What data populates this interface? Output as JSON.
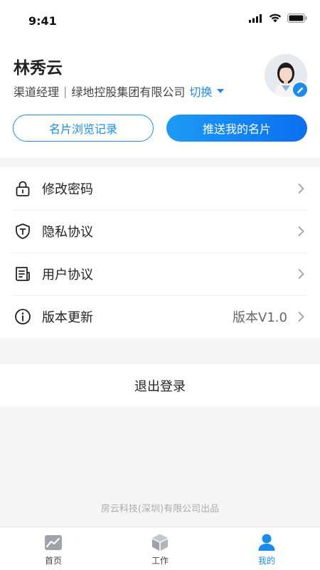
{
  "status_bar": {
    "time": "9:41"
  },
  "profile": {
    "name": "林秀云",
    "role": "渠道经理",
    "separator": "|",
    "company": "绿地控股集团有限公司",
    "switch_label": "切换"
  },
  "actions": {
    "browse_history_label": "名片浏览记录",
    "push_card_label": "推送我的名片"
  },
  "menu": [
    {
      "label": "修改密码",
      "value": "",
      "icon": "lock-icon"
    },
    {
      "label": "隐私协议",
      "value": "",
      "icon": "shield-icon"
    },
    {
      "label": "用户协议",
      "value": "",
      "icon": "document-icon"
    },
    {
      "label": "版本更新",
      "value": "版本V1.0",
      "icon": "info-icon"
    }
  ],
  "logout_label": "退出登录",
  "footer_note": "房云科技(深圳)有限公司出品",
  "tabs": [
    {
      "label": "首页",
      "icon": "home-chart-icon",
      "active": false
    },
    {
      "label": "工作",
      "icon": "box-icon",
      "active": false
    },
    {
      "label": "我的",
      "icon": "user-icon",
      "active": true
    }
  ],
  "colors": {
    "accent": "#1a8cf0",
    "background": "#f5f5f5"
  }
}
